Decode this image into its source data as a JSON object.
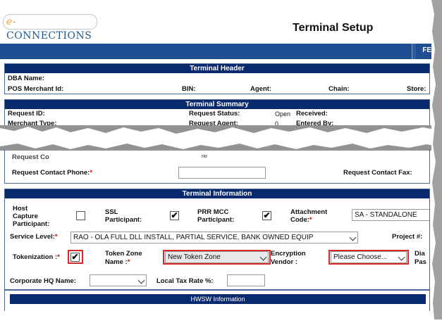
{
  "header": {
    "logo_e": "e-",
    "logo_text": "CONNECTIONS",
    "title": "Terminal Setup",
    "nav_fe": "FE"
  },
  "common": {
    "required_mark": "*",
    "check_glyph": "✔"
  },
  "terminal_header": {
    "title": "Terminal Header",
    "dba_name": "DBA Name:",
    "pos_merchant_id": "POS Merchant Id:",
    "bin": "BIN:",
    "agent": "Agent:",
    "chain": "Chain:",
    "store": "Store:"
  },
  "terminal_summary": {
    "title": "Terminal Summary",
    "request_id": "Request ID:",
    "request_status": "Request Status:",
    "request_status_value": "Open",
    "received": "Received:",
    "merchant_type": "Merchant Type:",
    "request_agent": "Request Agent:",
    "request_agent_value": "0",
    "entered_by": "Entered By:"
  },
  "request_contact": {
    "label_cut": "Request Co",
    "value_cut": "no",
    "phone_label": "Request Contact Phone:",
    "fax_label": "Request Contact Fax:"
  },
  "terminal_info": {
    "title": "Terminal Information",
    "host_capture_1": "Host",
    "host_capture_2": "Capture",
    "host_capture_3": "Participant:",
    "ssl_1": "SSL",
    "ssl_2": "Participant:",
    "prr_1": "PRR MCC",
    "prr_2": "Participant:",
    "attach_1": "Attachment",
    "attach_2": "Code:",
    "attach_value": "SA - STANDALONE",
    "service_level_label": "Service Level:",
    "service_level_value": "RAO - OLA FULL DLL INSTALL, PARTIAL SERVICE, BANK OWNED EQUIP",
    "project_label": "Project #:",
    "tokenization_label": "Tokenization :",
    "token_zone_1": "Token Zone",
    "token_zone_2": "Name :",
    "token_zone_value": "New Token Zone",
    "enc_1": "Encryption",
    "enc_2": "Vendor :",
    "enc_value": "Please Choose...",
    "cut_1": "Dia",
    "cut_2": "Pas",
    "corp_hq_label": "Corporate HQ Name:",
    "local_tax_label": "Local Tax Rate %:"
  },
  "hwsw": {
    "title": "HWSW Information"
  }
}
